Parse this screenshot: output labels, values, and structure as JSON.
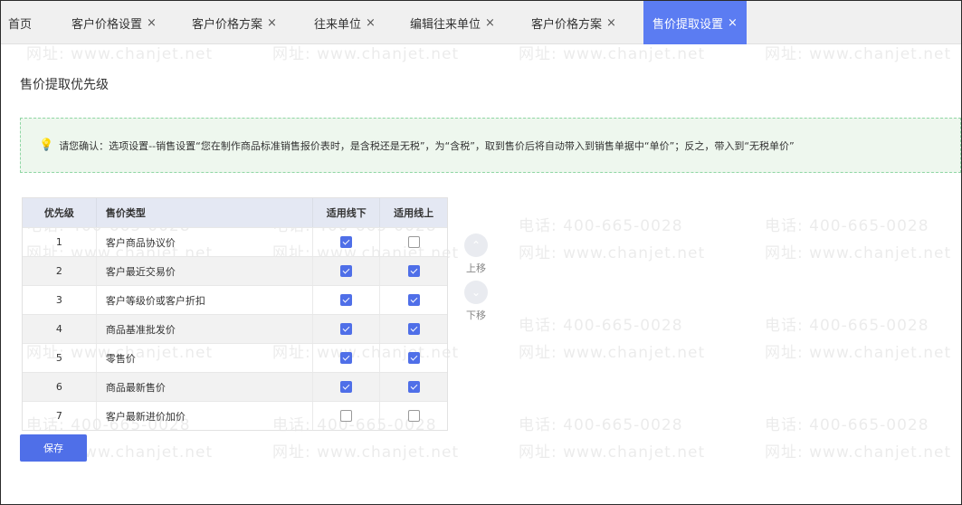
{
  "tabs": [
    {
      "label": "首页",
      "closable": false
    },
    {
      "label": "客户价格设置",
      "closable": true
    },
    {
      "label": "客户价格方案",
      "closable": true
    },
    {
      "label": "往来单位",
      "closable": true
    },
    {
      "label": "编辑往来单位",
      "closable": true
    },
    {
      "label": "客户价格方案",
      "closable": true
    },
    {
      "label": "售价提取设置",
      "closable": true,
      "active": true
    }
  ],
  "close_glyph": "×",
  "watermark": {
    "phone": "电话: 400-665-0028",
    "site": "网址: www.chanjet.net"
  },
  "section_title": "售价提取优先级",
  "tip": {
    "icon": "lightbulb-icon",
    "text": "请您确认：选项设置--销售设置“您在制作商品标准销售报价表时，是含税还是无税”，为“含税”，取到售价后将自动带入到销售单据中“单价”；反之，带入到“无税单价”"
  },
  "table": {
    "headers": [
      "优先级",
      "售价类型",
      "适用线下",
      "适用线上"
    ],
    "rows": [
      {
        "priority": "1",
        "type": "客户商品协议价",
        "offline": true,
        "online": false
      },
      {
        "priority": "2",
        "type": "客户最近交易价",
        "offline": true,
        "online": true
      },
      {
        "priority": "3",
        "type": "客户等级价或客户折扣",
        "offline": true,
        "online": true
      },
      {
        "priority": "4",
        "type": "商品基准批发价",
        "offline": true,
        "online": true
      },
      {
        "priority": "5",
        "type": "零售价",
        "offline": true,
        "online": true
      },
      {
        "priority": "6",
        "type": "商品最新售价",
        "offline": true,
        "online": true
      },
      {
        "priority": "7",
        "type": "客户最新进价加价",
        "offline": false,
        "online": false
      }
    ]
  },
  "move_up_label": "上移",
  "move_down_label": "下移",
  "save_label": "保存",
  "colors": {
    "accent": "#4f6fe8",
    "active_tab": "#5b7cf2",
    "tip_bg": "#eef7ee",
    "tip_border": "#8fd6a4"
  }
}
